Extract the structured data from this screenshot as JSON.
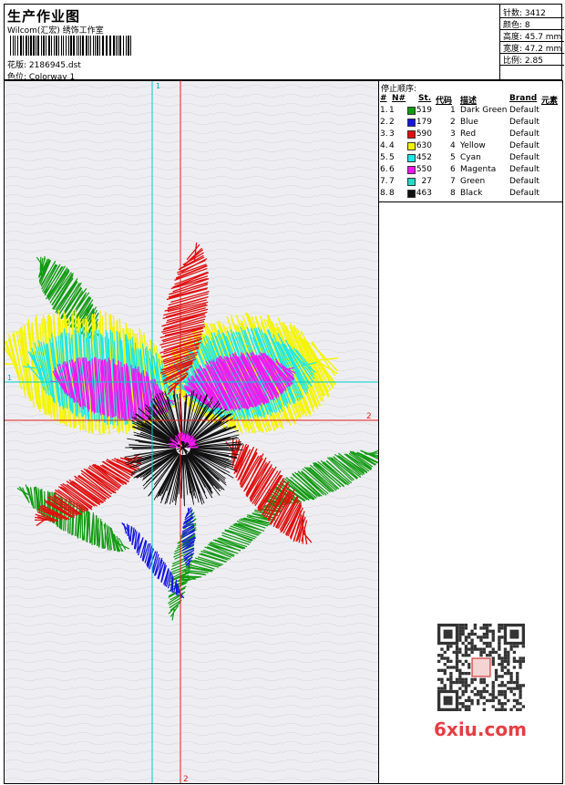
{
  "header": {
    "title": "生产作业图",
    "subtitle": "Wilcom(汇宏) 绣饰工作室",
    "design_label": "花版:",
    "design_value": "2186945.dst",
    "color_label": "色位:",
    "color_value": "Colorway 1"
  },
  "stats": {
    "stitches": "针数: 3412",
    "colors": "颜色: 8",
    "height": "高度: 45.7 mm",
    "width": "宽度: 47.2 mm",
    "ratio": "比例: 2.85"
  },
  "table": {
    "title": "停止顺序:",
    "headers": {
      "num": "#",
      "n": "N#",
      "st": "St.",
      "code": "代码",
      "desc": "描述",
      "brand": "Brand",
      "elem": "元素"
    },
    "rows": [
      {
        "num": "1.",
        "n": "1",
        "st": "519",
        "code": "1",
        "desc": "Dark Green",
        "brand": "Default",
        "color": "#139b13"
      },
      {
        "num": "2.",
        "n": "2",
        "st": "179",
        "code": "2",
        "desc": "Blue",
        "brand": "Default",
        "color": "#1616e0"
      },
      {
        "num": "3.",
        "n": "3",
        "st": "590",
        "code": "3",
        "desc": "Red",
        "brand": "Default",
        "color": "#e01010"
      },
      {
        "num": "4.",
        "n": "4",
        "st": "630",
        "code": "4",
        "desc": "Yellow",
        "brand": "Default",
        "color": "#f5f500"
      },
      {
        "num": "5.",
        "n": "5",
        "st": "452",
        "code": "5",
        "desc": "Cyan",
        "brand": "Default",
        "color": "#1ee8e8"
      },
      {
        "num": "6.",
        "n": "6",
        "st": "550",
        "code": "6",
        "desc": "Magenta",
        "brand": "Default",
        "color": "#f018f0"
      },
      {
        "num": "7.",
        "n": "7",
        "st": "27",
        "code": "7",
        "desc": "Green",
        "brand": "Default",
        "color": "#24d9c8"
      },
      {
        "num": "8.",
        "n": "8",
        "st": "463",
        "code": "8",
        "desc": "Black",
        "brand": "Default",
        "color": "#111111"
      }
    ]
  },
  "canvas": {
    "axis_v_top": "1",
    "axis_h_left": "1",
    "axis_h_right": "2",
    "axis_v_bottom": "2"
  },
  "watermark": {
    "text": "6xiu.com"
  }
}
